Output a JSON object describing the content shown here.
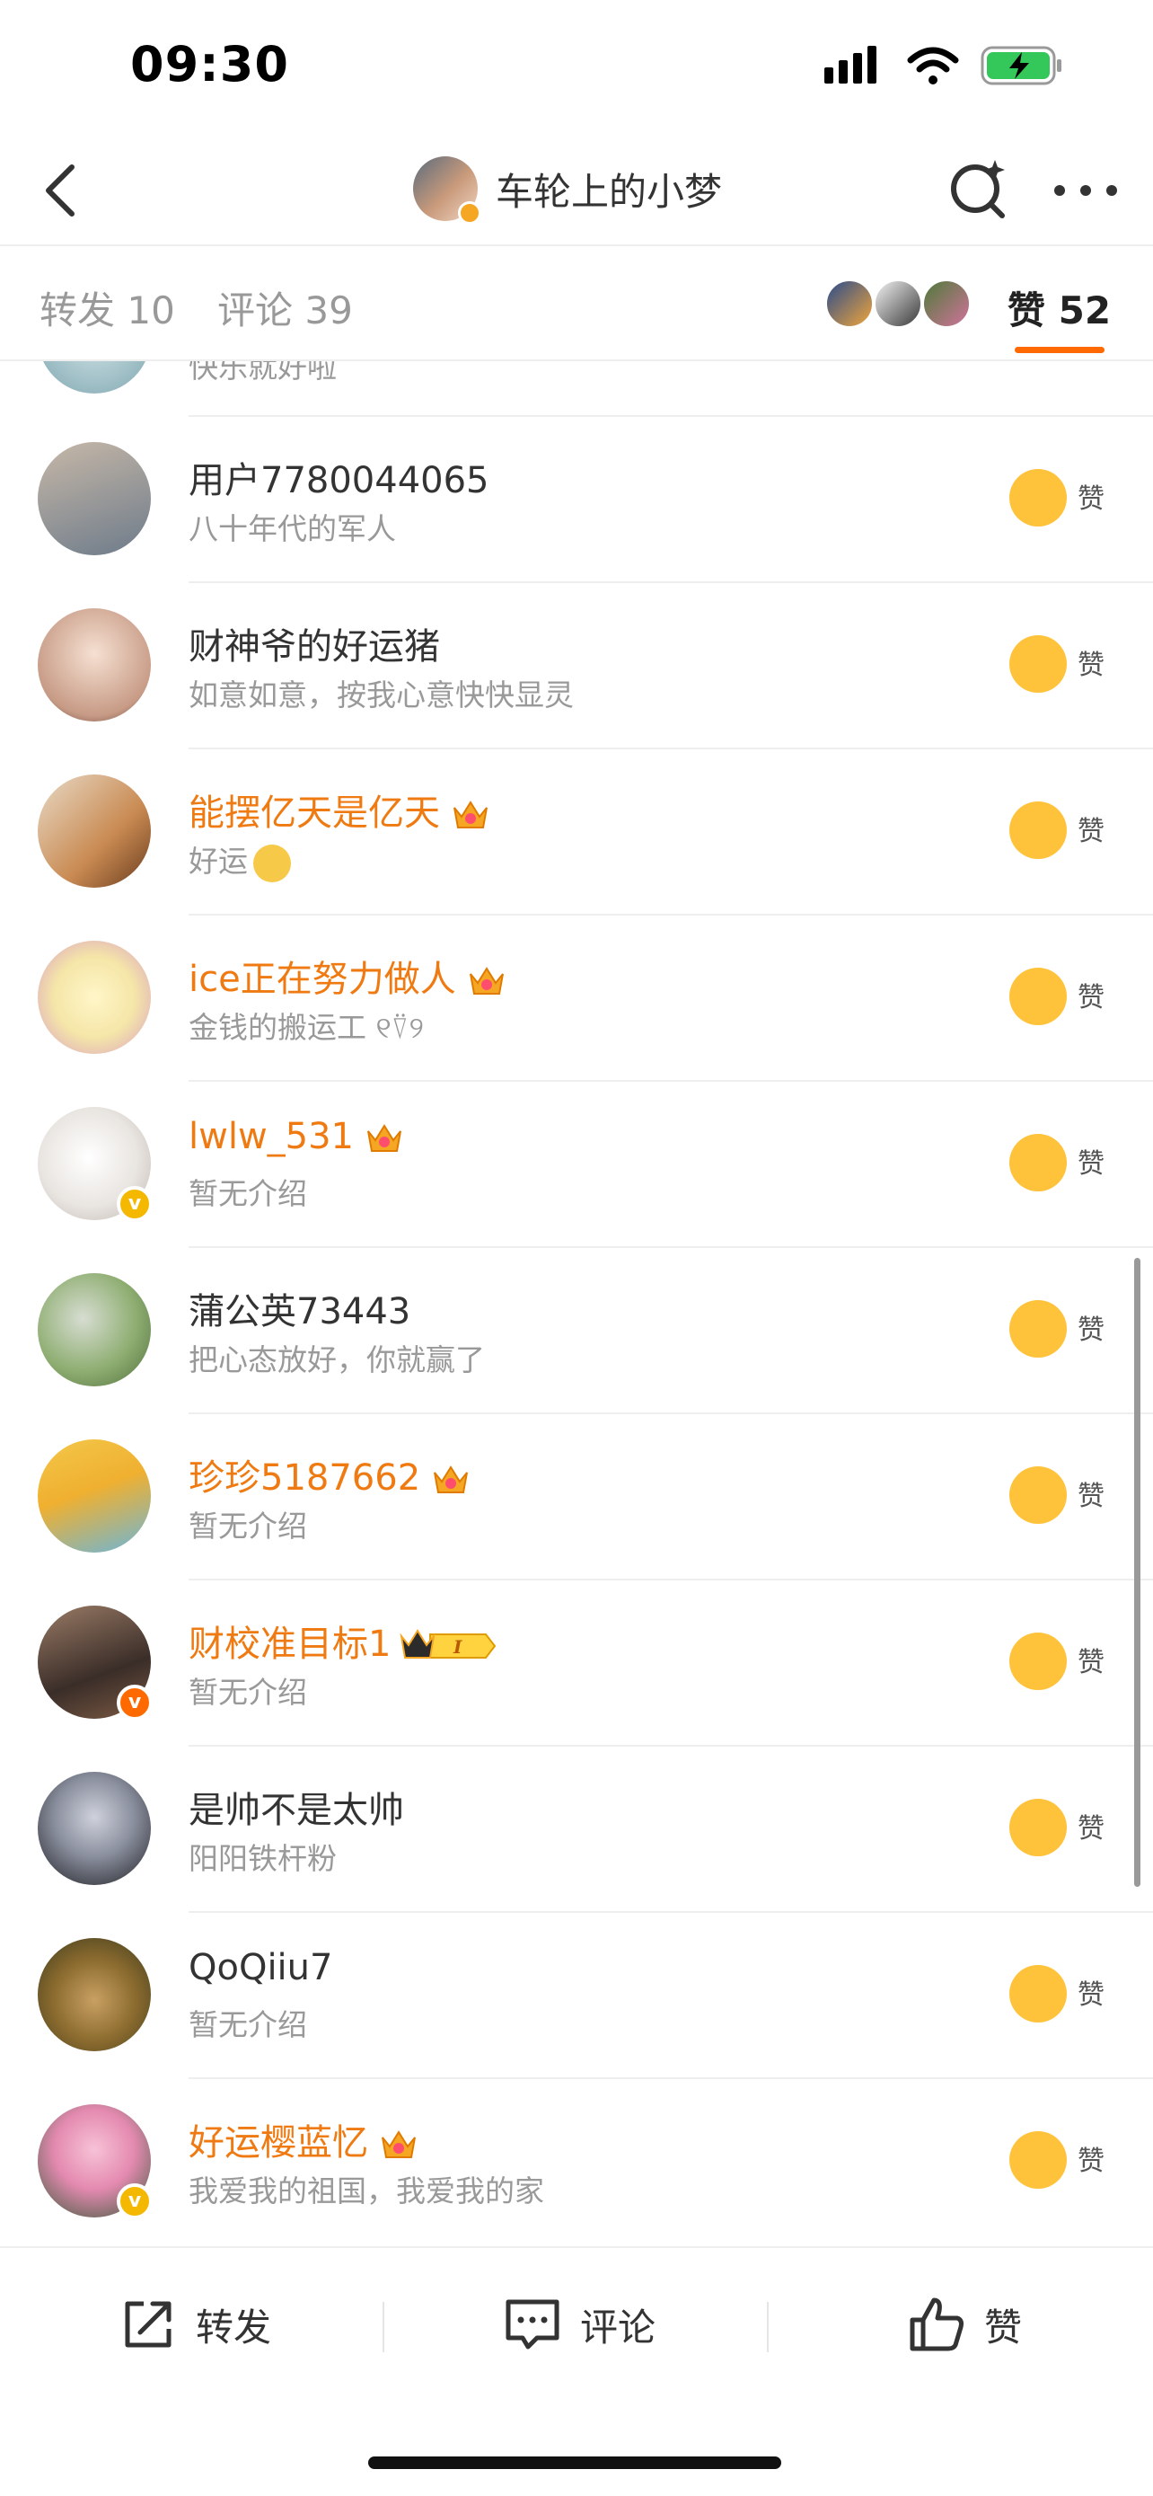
{
  "status_bar": {
    "time": "09:30"
  },
  "nav": {
    "title": "车轮上的小梦",
    "avatar_icon": "avatar-photo"
  },
  "tabs": {
    "repost": "转发 10",
    "comment": "评论 39",
    "like": "赞 52"
  },
  "likers": [
    {
      "name": "用户7780044065",
      "bio": "八十年代的军人",
      "vip": false,
      "avatar": [
        "#6d7b8a",
        "#c7b8a8"
      ]
    },
    {
      "name": "财神爷的好运猪",
      "bio": "如意如意，按我心意快快显灵",
      "vip": false,
      "avatar": [
        "#f1d3c0",
        "#5b3b2e"
      ]
    },
    {
      "name": "能摆亿天是亿天",
      "bio": "好运",
      "vip": true,
      "crown": "crown-badge",
      "emoji": "nerd-face-emoji",
      "avatar": [
        "#c98a52",
        "#e8dac6"
      ]
    },
    {
      "name": "ice正在努力做人",
      "bio": "金钱的搬运工 ୧⍢୨",
      "vip": true,
      "crown": "crown-badge",
      "avatar": [
        "#f5e6a8",
        "#d89cc3"
      ]
    },
    {
      "name": "lwlw_531",
      "bio": "暂无介绍",
      "vip": true,
      "crown": "crown-badge",
      "badge": "gold",
      "avatar": [
        "#f3f0ec",
        "#cfc6be"
      ]
    },
    {
      "name": "蒲公英73443",
      "bio": "把心态放好，你就赢了",
      "vip": false,
      "avatar": [
        "#6f8f5a",
        "#d7ddd2"
      ]
    },
    {
      "name": "珍珍5187662",
      "bio": "暂无介绍",
      "vip": true,
      "crown": "crown-badge",
      "avatar": [
        "#f3c74a",
        "#6bb6d9"
      ]
    },
    {
      "name": "财校准目标1",
      "bio": "暂无介绍",
      "vip": true,
      "crown": "crown-level-badge",
      "badge": "orange",
      "avatar": [
        "#3a2d28",
        "#9a7b66"
      ]
    },
    {
      "name": "是帅不是太帅",
      "bio": "阳阳铁杆粉",
      "vip": false,
      "avatar": [
        "#1e1e22",
        "#8a8f9e"
      ]
    },
    {
      "name": "QoQiiu7",
      "bio": "暂无介绍",
      "vip": false,
      "avatar": [
        "#3b3a1e",
        "#c9a063"
      ]
    },
    {
      "name": "好运樱蓝忆",
      "bio": "我爱我的祖国，我爱我的家",
      "vip": true,
      "crown": "crown-badge",
      "badge": "gold",
      "avatar": [
        "#e48ab0",
        "#3a5a3a"
      ]
    }
  ],
  "like_label": "赞",
  "partial_row_bio": "快乐就好啦",
  "bottom_bar": {
    "repost": "转发",
    "comment": "评论",
    "like": "赞"
  },
  "colors": {
    "accent": "#ff6900",
    "vip_name": "#ef7a12",
    "like_button": "#ffc23b"
  }
}
